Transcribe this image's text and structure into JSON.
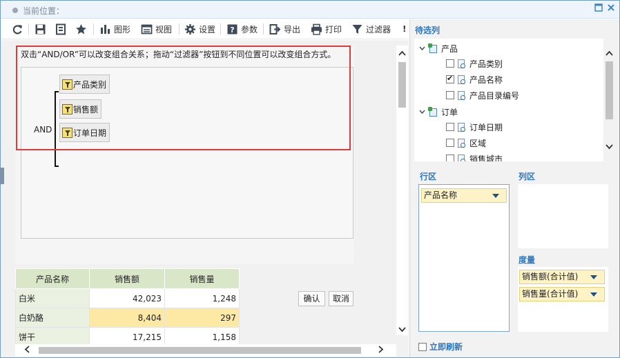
{
  "window": {
    "title": "当前位置：",
    "maximize_icon": "maximize-icon",
    "close_icon": "close-icon"
  },
  "toolbar": {
    "refresh_icon": "refresh-icon",
    "save_icon": "save-icon",
    "save_as_icon": "save-as-icon",
    "favorite_icon": "star-icon",
    "chart_label": "图形",
    "view_label": "视图",
    "settings_label": "设置",
    "params_label": "参数",
    "export_label": "导出",
    "print_label": "打印",
    "filter_label": "过滤器",
    "more_label": "!"
  },
  "filter": {
    "hint": "双击“AND/OR”可以改变组合关系；拖动“过滤器”按钮到不同位置可以改变组合方式。",
    "operator": "AND",
    "conditions": [
      "产品类别",
      "销售额",
      "订单日期"
    ],
    "confirm_label": "确认",
    "cancel_label": "取消"
  },
  "table": {
    "headers": [
      "产品名称",
      "销售额",
      "销售量"
    ],
    "rows": [
      [
        "白米",
        "42,023",
        "1,248"
      ],
      [
        "白奶酪",
        "8,404",
        "297"
      ],
      [
        "饼干",
        "17,215",
        "1,158"
      ]
    ],
    "highlight_row": 1
  },
  "right_panel": {
    "candidates_title": "待选列",
    "tree": [
      {
        "label": "产品",
        "type": "table",
        "expanded": true
      },
      {
        "label": "产品类别",
        "type": "field",
        "checked": false
      },
      {
        "label": "产品名称",
        "type": "field",
        "checked": true
      },
      {
        "label": "产品目录编号",
        "type": "field",
        "checked": false
      },
      {
        "label": "订单",
        "type": "table",
        "expanded": true
      },
      {
        "label": "订单日期",
        "type": "field",
        "checked": false
      },
      {
        "label": "区域",
        "type": "field",
        "checked": false
      },
      {
        "label": "销售城市",
        "type": "field",
        "checked": false
      }
    ],
    "rows_zone_title": "行区",
    "cols_zone_title": "列区",
    "measures_title": "度量",
    "row_fields": [
      "产品名称"
    ],
    "measures": [
      "销售额(合计值)",
      "销售量(合计值)"
    ],
    "auto_refresh_label": "立即刷新",
    "auto_refresh_checked": false
  },
  "colors": {
    "accent": "#2f76bd",
    "highlight_border": "#e2383c",
    "table_header": "#d9e6c8",
    "cell_highlight": "#fde8a4",
    "pill": "#fdf3c6"
  }
}
